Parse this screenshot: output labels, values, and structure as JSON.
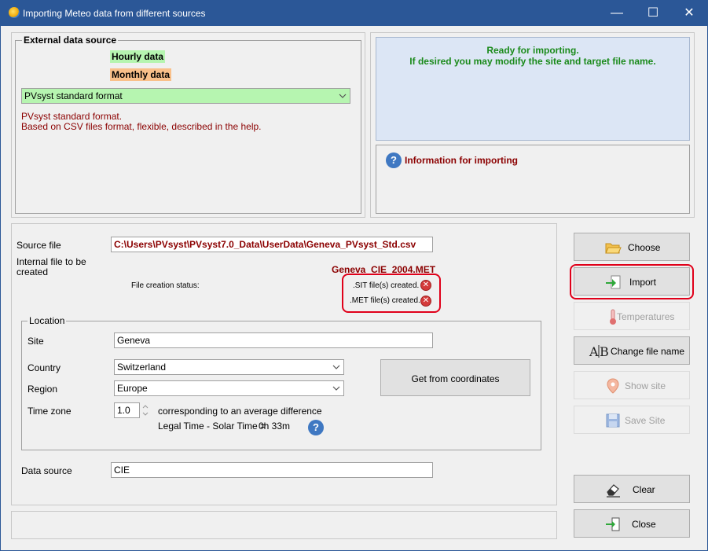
{
  "window": {
    "title": "Importing Meteo data from different sources",
    "controls": {
      "minimize": "—",
      "maximize": "☐",
      "close": "✕"
    }
  },
  "external_source": {
    "legend": "External data source",
    "hourly_tag": "Hourly data",
    "monthly_tag": "Monthly data",
    "format_select": "PVsyst standard format",
    "desc_line1": "PVsyst standard format.",
    "desc_line2": "Based on CSV files format, flexible, described in the help."
  },
  "status_panel": {
    "line1": "Ready for importing.",
    "line2": "If desired you may modify the site and target file name."
  },
  "info_panel": {
    "title": "Information for importing"
  },
  "file_section": {
    "source_file_label": "Source file",
    "source_file_value": "C:\\Users\\PVsyst\\PVsyst7.0_Data\\UserData\\Geneva_PVsyst_Std.csv",
    "internal_file_label_1": "Internal file to be",
    "internal_file_label_2": "created",
    "internal_file_value": "Geneva_CIE_2004.MET",
    "creation_status_label": "File creation status:",
    "sit_status": ".SIT file(s) created.",
    "met_status": ".MET file(s) created."
  },
  "location": {
    "legend": "Location",
    "site_label": "Site",
    "site_value": "Geneva",
    "country_label": "Country",
    "country_value": "Switzerland",
    "region_label": "Region",
    "region_value": "Europe",
    "timezone_label": "Time zone",
    "timezone_value": "1.0",
    "timezone_desc": "corresponding to an average difference",
    "legal_time_label": "Legal Time - Solar Time =",
    "legal_time_value": "0h 33m",
    "get_coords_button": "Get from coordinates"
  },
  "data_source": {
    "label": "Data source",
    "value": "CIE"
  },
  "buttons": {
    "choose": "Choose",
    "import": "Import",
    "temperatures": "Temperatures",
    "change_file_name": "Change file name",
    "show_site": "Show site",
    "save_site": "Save Site",
    "clear": "Clear",
    "close": "Close"
  },
  "colors": {
    "titlebar": "#2b5797",
    "hourly_bg": "#b6f5b0",
    "monthly_bg": "#f9c08a",
    "status_panel_bg": "#dce6f5",
    "status_text": "#1a8a1a",
    "dark_red_text": "#8b0000",
    "highlight_outline": "#e0001a"
  }
}
